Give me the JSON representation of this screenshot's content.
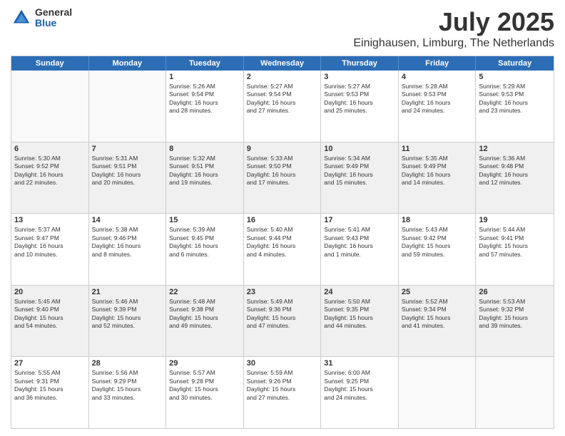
{
  "logo": {
    "general": "General",
    "blue": "Blue"
  },
  "title": "July 2025",
  "subtitle": "Einighausen, Limburg, The Netherlands",
  "weekdays": [
    "Sunday",
    "Monday",
    "Tuesday",
    "Wednesday",
    "Thursday",
    "Friday",
    "Saturday"
  ],
  "rows": [
    {
      "shaded": false,
      "cells": [
        {
          "day": "",
          "empty": true,
          "text": ""
        },
        {
          "day": "",
          "empty": true,
          "text": ""
        },
        {
          "day": "1",
          "empty": false,
          "text": "Sunrise: 5:26 AM\nSunset: 9:54 PM\nDaylight: 16 hours\nand 28 minutes."
        },
        {
          "day": "2",
          "empty": false,
          "text": "Sunrise: 5:27 AM\nSunset: 9:54 PM\nDaylight: 16 hours\nand 27 minutes."
        },
        {
          "day": "3",
          "empty": false,
          "text": "Sunrise: 5:27 AM\nSunset: 9:53 PM\nDaylight: 16 hours\nand 25 minutes."
        },
        {
          "day": "4",
          "empty": false,
          "text": "Sunrise: 5:28 AM\nSunset: 9:53 PM\nDaylight: 16 hours\nand 24 minutes."
        },
        {
          "day": "5",
          "empty": false,
          "text": "Sunrise: 5:29 AM\nSunset: 9:53 PM\nDaylight: 16 hours\nand 23 minutes."
        }
      ]
    },
    {
      "shaded": true,
      "cells": [
        {
          "day": "6",
          "empty": false,
          "text": "Sunrise: 5:30 AM\nSunset: 9:52 PM\nDaylight: 16 hours\nand 22 minutes."
        },
        {
          "day": "7",
          "empty": false,
          "text": "Sunrise: 5:31 AM\nSunset: 9:51 PM\nDaylight: 16 hours\nand 20 minutes."
        },
        {
          "day": "8",
          "empty": false,
          "text": "Sunrise: 5:32 AM\nSunset: 9:51 PM\nDaylight: 16 hours\nand 19 minutes."
        },
        {
          "day": "9",
          "empty": false,
          "text": "Sunrise: 5:33 AM\nSunset: 9:50 PM\nDaylight: 16 hours\nand 17 minutes."
        },
        {
          "day": "10",
          "empty": false,
          "text": "Sunrise: 5:34 AM\nSunset: 9:49 PM\nDaylight: 16 hours\nand 15 minutes."
        },
        {
          "day": "11",
          "empty": false,
          "text": "Sunrise: 5:35 AM\nSunset: 9:49 PM\nDaylight: 16 hours\nand 14 minutes."
        },
        {
          "day": "12",
          "empty": false,
          "text": "Sunrise: 5:36 AM\nSunset: 9:48 PM\nDaylight: 16 hours\nand 12 minutes."
        }
      ]
    },
    {
      "shaded": false,
      "cells": [
        {
          "day": "13",
          "empty": false,
          "text": "Sunrise: 5:37 AM\nSunset: 9:47 PM\nDaylight: 16 hours\nand 10 minutes."
        },
        {
          "day": "14",
          "empty": false,
          "text": "Sunrise: 5:38 AM\nSunset: 9:46 PM\nDaylight: 16 hours\nand 8 minutes."
        },
        {
          "day": "15",
          "empty": false,
          "text": "Sunrise: 5:39 AM\nSunset: 9:45 PM\nDaylight: 16 hours\nand 6 minutes."
        },
        {
          "day": "16",
          "empty": false,
          "text": "Sunrise: 5:40 AM\nSunset: 9:44 PM\nDaylight: 16 hours\nand 4 minutes."
        },
        {
          "day": "17",
          "empty": false,
          "text": "Sunrise: 5:41 AM\nSunset: 9:43 PM\nDaylight: 16 hours\nand 1 minute."
        },
        {
          "day": "18",
          "empty": false,
          "text": "Sunrise: 5:43 AM\nSunset: 9:42 PM\nDaylight: 15 hours\nand 59 minutes."
        },
        {
          "day": "19",
          "empty": false,
          "text": "Sunrise: 5:44 AM\nSunset: 9:41 PM\nDaylight: 15 hours\nand 57 minutes."
        }
      ]
    },
    {
      "shaded": true,
      "cells": [
        {
          "day": "20",
          "empty": false,
          "text": "Sunrise: 5:45 AM\nSunset: 9:40 PM\nDaylight: 15 hours\nand 54 minutes."
        },
        {
          "day": "21",
          "empty": false,
          "text": "Sunrise: 5:46 AM\nSunset: 9:39 PM\nDaylight: 15 hours\nand 52 minutes."
        },
        {
          "day": "22",
          "empty": false,
          "text": "Sunrise: 5:48 AM\nSunset: 9:38 PM\nDaylight: 15 hours\nand 49 minutes."
        },
        {
          "day": "23",
          "empty": false,
          "text": "Sunrise: 5:49 AM\nSunset: 9:36 PM\nDaylight: 15 hours\nand 47 minutes."
        },
        {
          "day": "24",
          "empty": false,
          "text": "Sunrise: 5:50 AM\nSunset: 9:35 PM\nDaylight: 15 hours\nand 44 minutes."
        },
        {
          "day": "25",
          "empty": false,
          "text": "Sunrise: 5:52 AM\nSunset: 9:34 PM\nDaylight: 15 hours\nand 41 minutes."
        },
        {
          "day": "26",
          "empty": false,
          "text": "Sunrise: 5:53 AM\nSunset: 9:32 PM\nDaylight: 15 hours\nand 39 minutes."
        }
      ]
    },
    {
      "shaded": false,
      "cells": [
        {
          "day": "27",
          "empty": false,
          "text": "Sunrise: 5:55 AM\nSunset: 9:31 PM\nDaylight: 15 hours\nand 36 minutes."
        },
        {
          "day": "28",
          "empty": false,
          "text": "Sunrise: 5:56 AM\nSunset: 9:29 PM\nDaylight: 15 hours\nand 33 minutes."
        },
        {
          "day": "29",
          "empty": false,
          "text": "Sunrise: 5:57 AM\nSunset: 9:28 PM\nDaylight: 15 hours\nand 30 minutes."
        },
        {
          "day": "30",
          "empty": false,
          "text": "Sunrise: 5:59 AM\nSunset: 9:26 PM\nDaylight: 15 hours\nand 27 minutes."
        },
        {
          "day": "31",
          "empty": false,
          "text": "Sunrise: 6:00 AM\nSunset: 9:25 PM\nDaylight: 15 hours\nand 24 minutes."
        },
        {
          "day": "",
          "empty": true,
          "text": ""
        },
        {
          "day": "",
          "empty": true,
          "text": ""
        }
      ]
    }
  ]
}
